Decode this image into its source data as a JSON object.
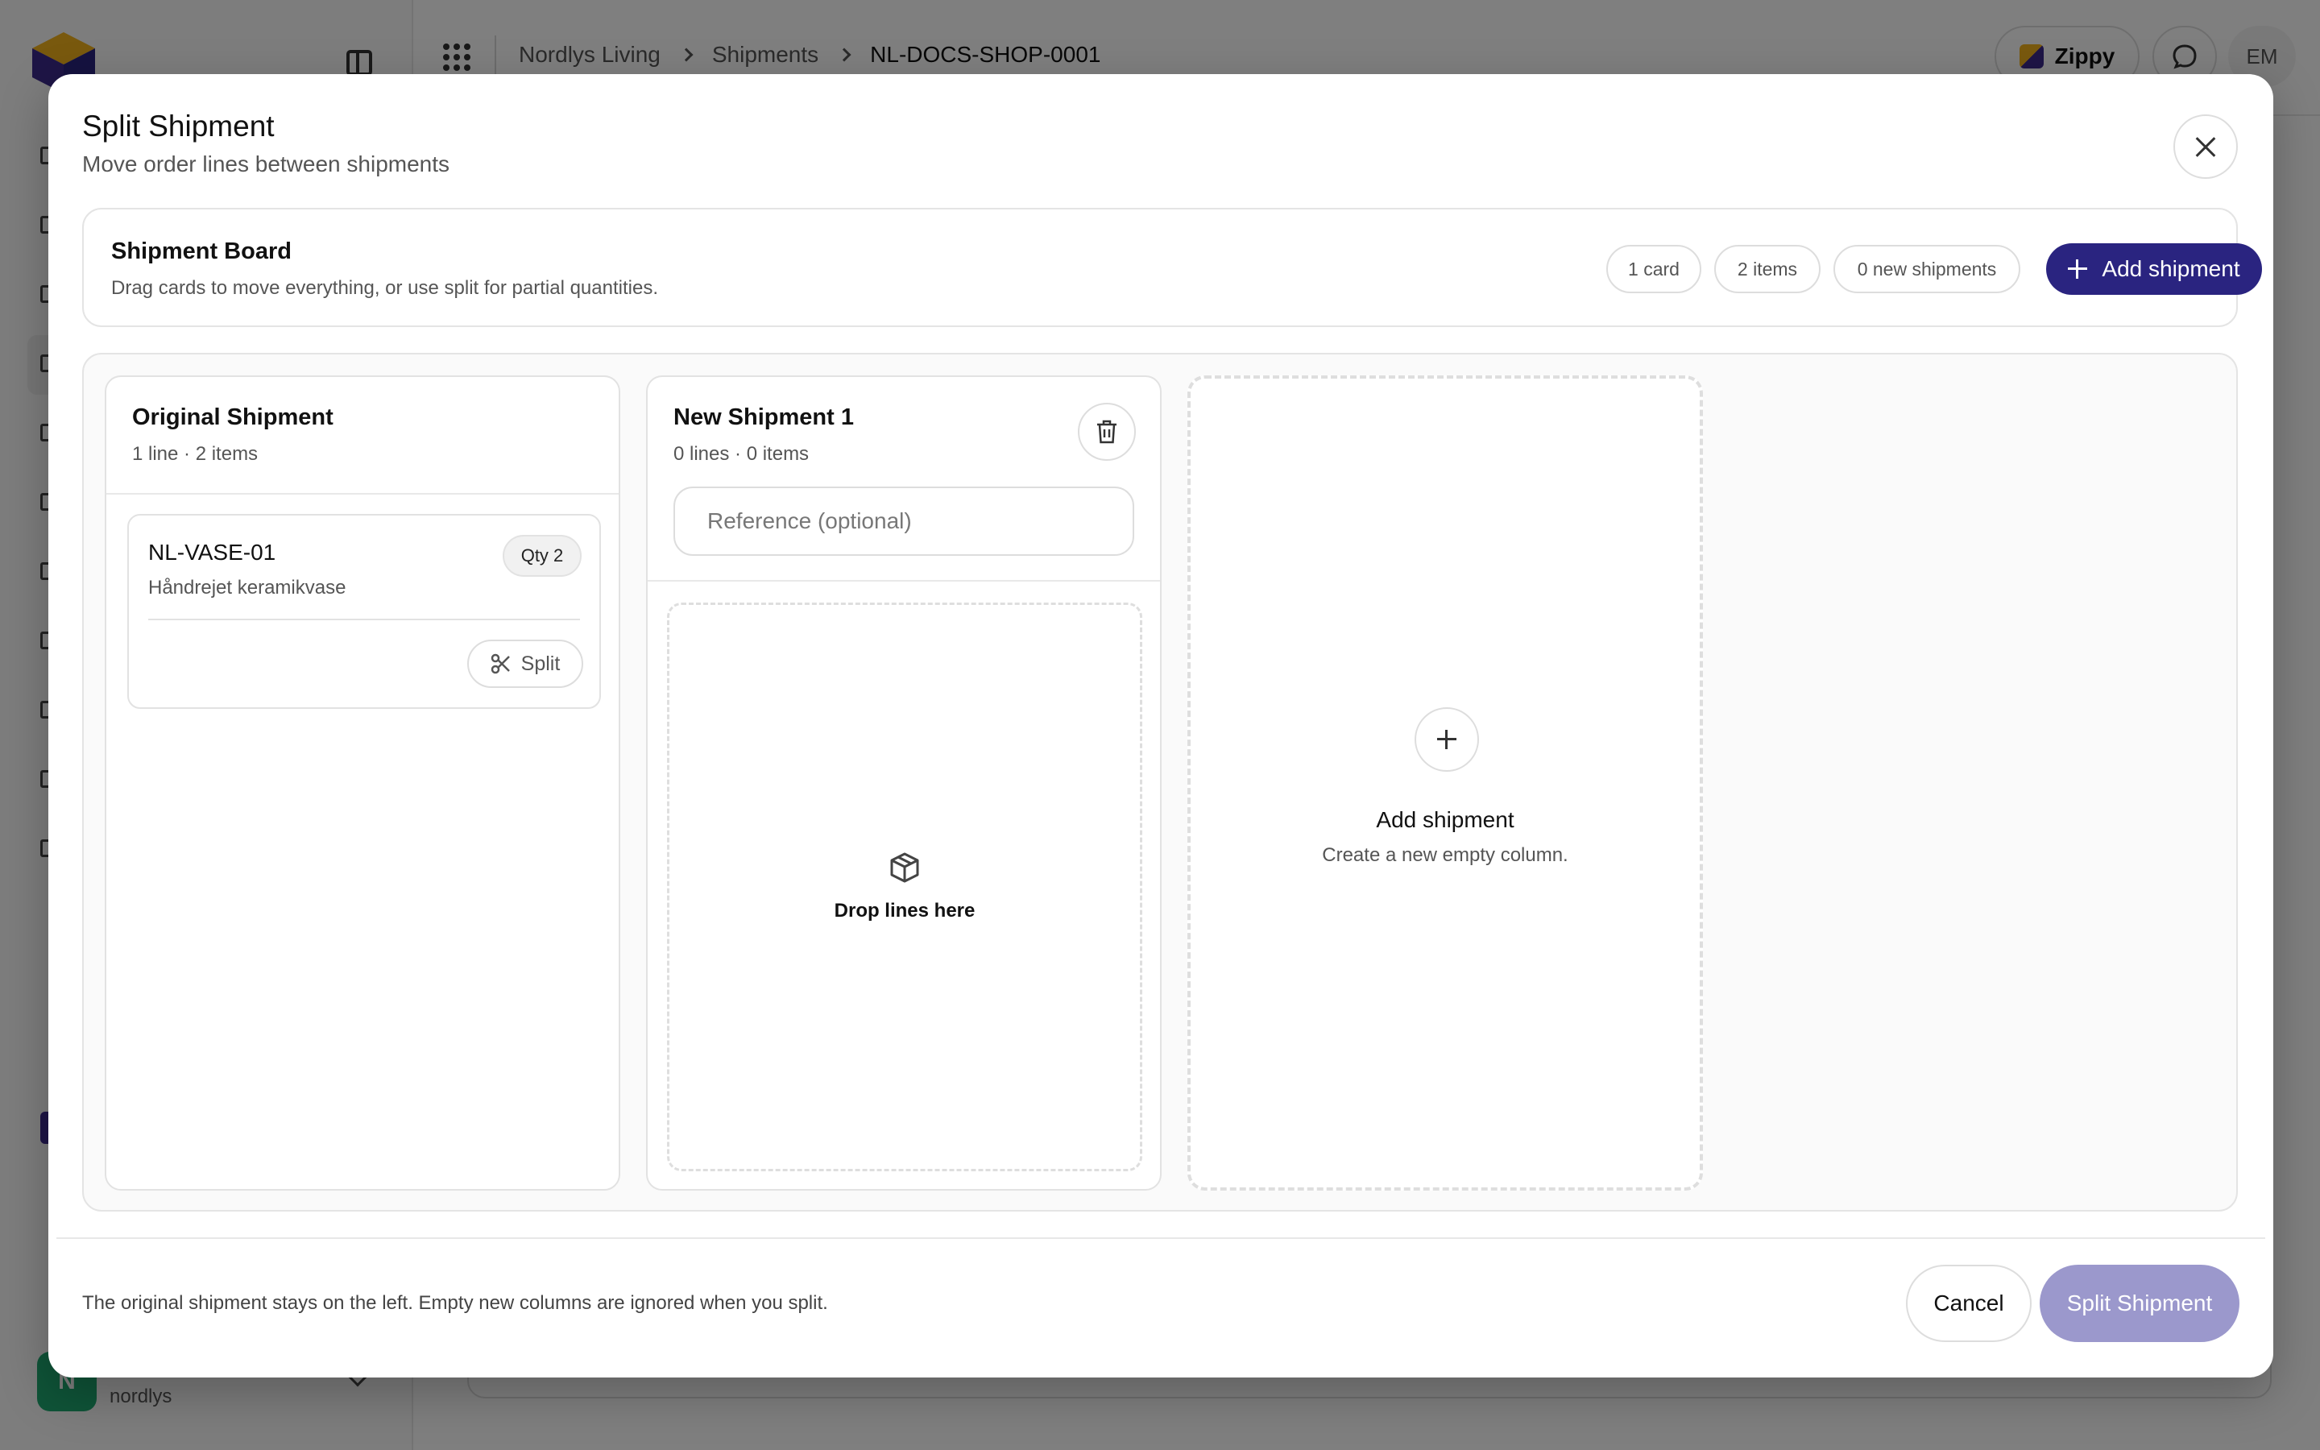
{
  "app": {
    "breadcrumbs": [
      "Nordlys Living",
      "Shipments",
      "NL-DOCS-SHOP-0001"
    ],
    "assistant_label": "Zippy",
    "user_initials": "EM",
    "workspace_initial": "N",
    "workspace_handle": "nordlys"
  },
  "modal": {
    "title": "Split Shipment",
    "subtitle": "Move order lines between shipments",
    "board_header": {
      "title": "Shipment Board",
      "description": "Drag cards to move everything, or use split for partial quantities.",
      "pills": [
        "1 card",
        "2 items",
        "0 new shipments"
      ],
      "add_label": "Add shipment"
    },
    "original": {
      "title": "Original Shipment",
      "meta": "1 line · 2 items",
      "lines": [
        {
          "sku": "NL-VASE-01",
          "name": "Håndrejet keramikvase",
          "qty": "Qty 2",
          "split_label": "Split"
        }
      ]
    },
    "new_shipments": [
      {
        "title": "New Shipment 1",
        "meta": "0 lines · 0 items",
        "reference_placeholder": "Reference (optional)",
        "drop_label": "Drop lines here"
      }
    ],
    "add_column": {
      "title": "Add shipment",
      "description": "Create a new empty column."
    },
    "footer": {
      "note": "The original shipment stays on the left. Empty new columns are ignored when you split.",
      "cancel_label": "Cancel",
      "submit_label": "Split Shipment"
    }
  },
  "colors": {
    "primary": "#2a2480",
    "primary_disabled": "#9b98cc",
    "workspace_avatar": "#1fa870"
  },
  "icons": [
    "app-logo-icon",
    "sidebar-toggle-icon",
    "apps-grid-icon",
    "chevron-right-icon",
    "zippy-logo-icon",
    "chat-icon",
    "close-icon",
    "plus-icon",
    "scissors-icon",
    "trash-icon",
    "package-icon",
    "chevron-down-icon"
  ]
}
